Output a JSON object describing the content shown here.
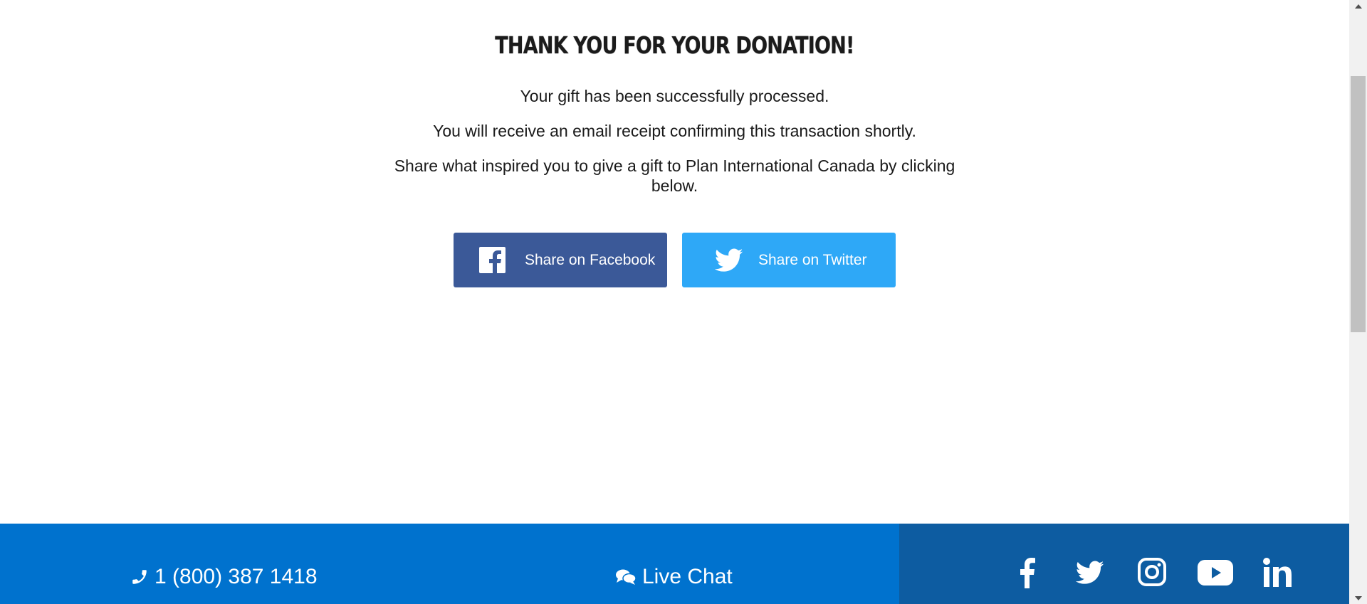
{
  "main": {
    "title": "THANK YOU FOR YOUR DONATION!",
    "message1": "Your gift has been successfully processed.",
    "message2": "You will receive an email receipt confirming this transaction shortly.",
    "message3": "Share what inspired you to give a gift to Plan International Canada by clicking below.",
    "facebook_button": {
      "label": "Share on Facebook",
      "icon": "facebook-icon",
      "color": "#3b5998"
    },
    "twitter_button": {
      "label": "Share on Twitter",
      "icon": "twitter-icon",
      "color": "#2ea8f7"
    }
  },
  "footer": {
    "phone": {
      "icon": "phone-icon",
      "label": "1 (800) 387 1418"
    },
    "chat": {
      "icon": "chat-icon",
      "label": "Live Chat"
    },
    "social": [
      "facebook-icon",
      "twitter-icon",
      "instagram-icon",
      "youtube-icon",
      "linkedin-icon"
    ],
    "colors": {
      "primary": "#0072ce",
      "secondary": "#0d5ca1"
    }
  }
}
